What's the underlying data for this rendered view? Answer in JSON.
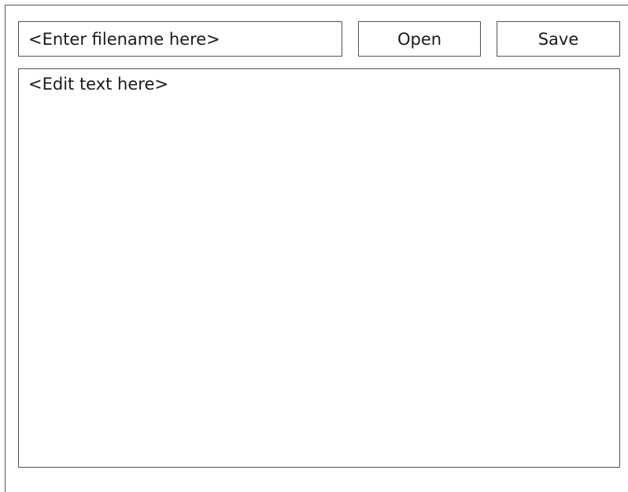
{
  "toolbar": {
    "filename_placeholder": "<Enter filename here>",
    "open_label": "Open",
    "save_label": "Save"
  },
  "editor": {
    "placeholder": "<Edit text here>"
  }
}
